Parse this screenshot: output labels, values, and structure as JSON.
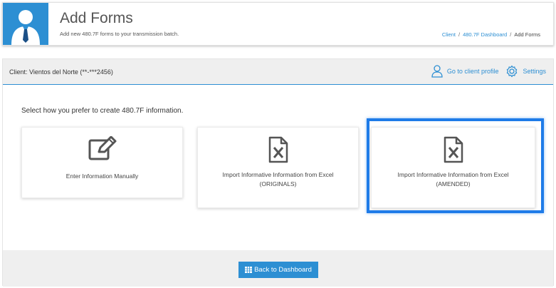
{
  "header": {
    "title": "Add Forms",
    "subtitle": "Add new 480.7F forms to your transmission batch.",
    "breadcrumb": {
      "client": "Client",
      "dashboard": "480.7F Dashboard",
      "current": "Add Forms",
      "separator": "/"
    }
  },
  "client_bar": {
    "client_label": "Client: Vientos del Norte (**-***2456)",
    "profile_link": "Go to client profile",
    "settings_link": "Settings"
  },
  "main": {
    "prompt": "Select how you prefer to create 480.7F information.",
    "options": [
      {
        "icon": "edit-icon",
        "label_line1": "Enter Information Manually",
        "label_line2": ""
      },
      {
        "icon": "excel-file-icon",
        "label_line1": "Import Informative Information from Excel",
        "label_line2": "(ORIGINALS)"
      },
      {
        "icon": "excel-file-icon",
        "label_line1": "Import Informative Information from Excel",
        "label_line2": "(AMENDED)"
      }
    ]
  },
  "footer": {
    "back_label": "Back to Dashboard"
  },
  "colors": {
    "accent": "#2d8fd3",
    "highlight": "#1e7be8",
    "bar_bg": "#efefef"
  }
}
